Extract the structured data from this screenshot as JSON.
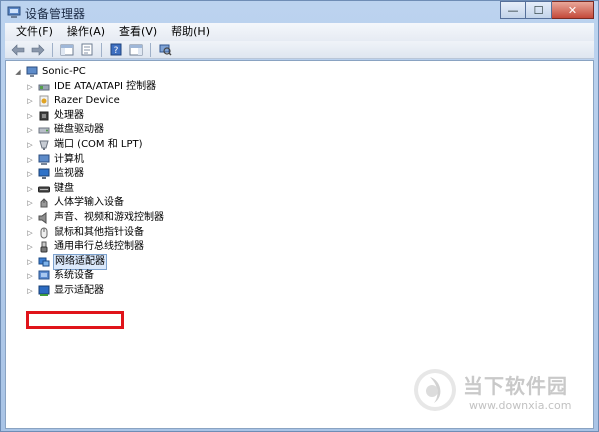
{
  "window": {
    "title": "设备管理器"
  },
  "caption": {
    "minimize": "—",
    "maximize": "☐",
    "close": "✕"
  },
  "menu": [
    {
      "label": "文件(F)"
    },
    {
      "label": "操作(A)"
    },
    {
      "label": "查看(V)"
    },
    {
      "label": "帮助(H)"
    }
  ],
  "toolbar": {
    "icons": [
      "back-arrow-icon",
      "forward-arrow-icon",
      "show-hide-console-tree-icon",
      "properties-icon",
      "help-icon",
      "show-hide-action-pane-icon",
      "scan-hardware-icon"
    ]
  },
  "tree": {
    "root": {
      "label": "Sonic-PC",
      "expander": "◢"
    },
    "items": [
      {
        "label": "IDE ATA/ATAPI 控制器",
        "icon": "ide-controller-icon"
      },
      {
        "label": "Razer Device",
        "icon": "razer-device-icon"
      },
      {
        "label": "处理器",
        "icon": "processor-icon"
      },
      {
        "label": "磁盘驱动器",
        "icon": "disk-drive-icon"
      },
      {
        "label": "端口 (COM 和 LPT)",
        "icon": "port-icon"
      },
      {
        "label": "计算机",
        "icon": "computer-icon"
      },
      {
        "label": "监视器",
        "icon": "monitor-icon"
      },
      {
        "label": "键盘",
        "icon": "keyboard-icon"
      },
      {
        "label": "人体学输入设备",
        "icon": "hid-icon"
      },
      {
        "label": "声音、视频和游戏控制器",
        "icon": "sound-icon"
      },
      {
        "label": "鼠标和其他指针设备",
        "icon": "mouse-icon"
      },
      {
        "label": "通用串行总线控制器",
        "icon": "usb-icon"
      },
      {
        "label": "网络适配器",
        "icon": "network-adapter-icon",
        "selected": true
      },
      {
        "label": "系统设备",
        "icon": "system-device-icon"
      },
      {
        "label": "显示适配器",
        "icon": "display-adapter-icon"
      }
    ],
    "collapsed_expander": "▷"
  },
  "watermark": {
    "brand": "当下软件园",
    "url": "www.downxia.com"
  },
  "colors": {
    "highlight_box": "#e0141a",
    "selection": "#dbe9fb"
  }
}
